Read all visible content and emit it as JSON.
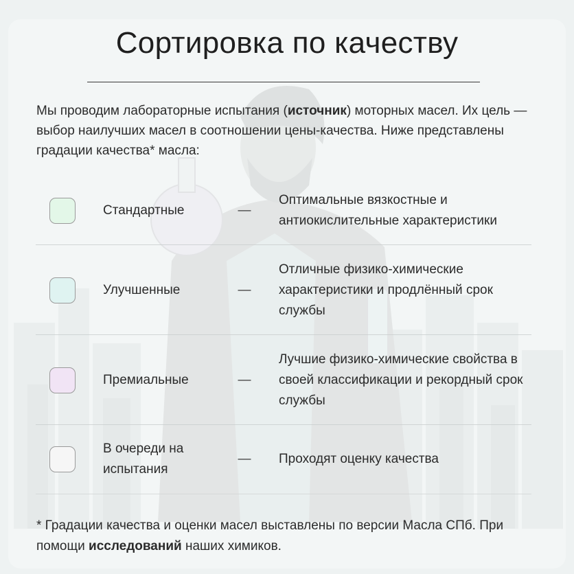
{
  "colors": {
    "standard": "#e3f7e8",
    "improved": "#dff3f1",
    "premium": "#f1e4f5",
    "pending": "#f6f6f6",
    "border": "#9a9a9a"
  },
  "title": "Сортировка по качеству",
  "intro": {
    "text_before": "Мы проводим лабораторные испытания (",
    "source_word": "источник",
    "text_after": ") моторных масел. Их цель — выбор наилучших масел в соотношении цены-качества. Ниже представлены градации качества* масла:"
  },
  "grades": [
    {
      "name": "Стандартные",
      "dash": "—",
      "description": "Оптимальные вязкостные и антиокислительные характеристики",
      "swatch_color": "#e3f7e8",
      "swatch_icon": "green-swatch-icon"
    },
    {
      "name": "Улучшенные",
      "dash": "—",
      "description": "Отличные физико-химические характеристики и продлённый срок службы",
      "swatch_color": "#dff3f1",
      "swatch_icon": "teal-swatch-icon"
    },
    {
      "name": "Премиальные",
      "dash": "—",
      "description": "Лучшие физико-химические свойства в своей классификации и рекордный срок службы",
      "swatch_color": "#f1e4f5",
      "swatch_icon": "lilac-swatch-icon"
    },
    {
      "name": "В очереди на испытания",
      "dash": "—",
      "description": "Проходят оценку качества",
      "swatch_color": "#f6f6f6",
      "swatch_icon": "white-swatch-icon"
    }
  ],
  "footnote": {
    "text_before": "* Градации качества и оценки масел выставлены по версии Масла СПб. При помощи ",
    "research_word": "исследований",
    "text_after": " наших химиков."
  }
}
